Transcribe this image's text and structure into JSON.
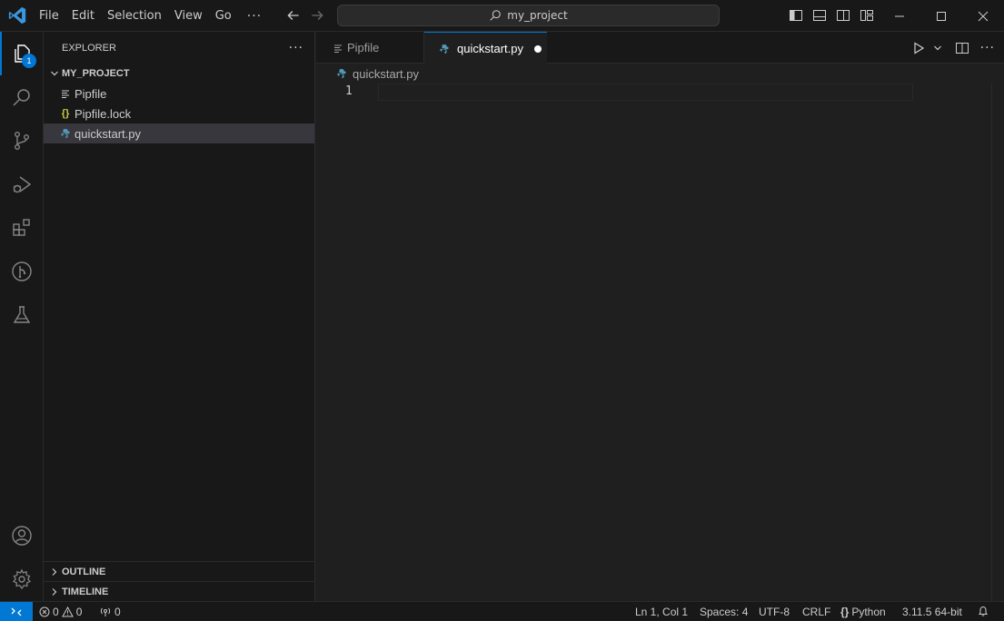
{
  "titlebar": {
    "menu": [
      "File",
      "Edit",
      "Selection",
      "View",
      "Go"
    ],
    "more": "···",
    "search_text": "my_project"
  },
  "activity": {
    "explorer_badge": "1",
    "icons": [
      "files-icon",
      "search-icon",
      "source-control-icon",
      "run-debug-icon",
      "extensions-icon",
      "git-graph-icon",
      "testing-icon",
      "account-icon",
      "settings-gear-icon"
    ]
  },
  "sidebar": {
    "title": "EXPLORER",
    "more": "···",
    "project": "MY_PROJECT",
    "files": [
      {
        "name": "Pipfile",
        "icon": "≡"
      },
      {
        "name": "Pipfile.lock",
        "icon": "{}"
      },
      {
        "name": "quickstart.py",
        "icon": "py"
      }
    ],
    "outline": "OUTLINE",
    "timeline": "TIMELINE"
  },
  "tabs": [
    {
      "label": "Pipfile"
    },
    {
      "label": "quickstart.py"
    }
  ],
  "breadcrumb": "quickstart.py",
  "editor": {
    "line_number": "1"
  },
  "status": {
    "errors": "0",
    "warnings": "0",
    "ports": "0",
    "position": "Ln 1, Col 1",
    "spaces": "Spaces: 4",
    "encoding": "UTF-8",
    "eol": "CRLF",
    "language": "Python",
    "interpreter": "3.11.5 64-bit"
  },
  "colors": {
    "accent": "#0078d4",
    "python_icon": "#519aba",
    "json_icon": "#cbcb41"
  }
}
